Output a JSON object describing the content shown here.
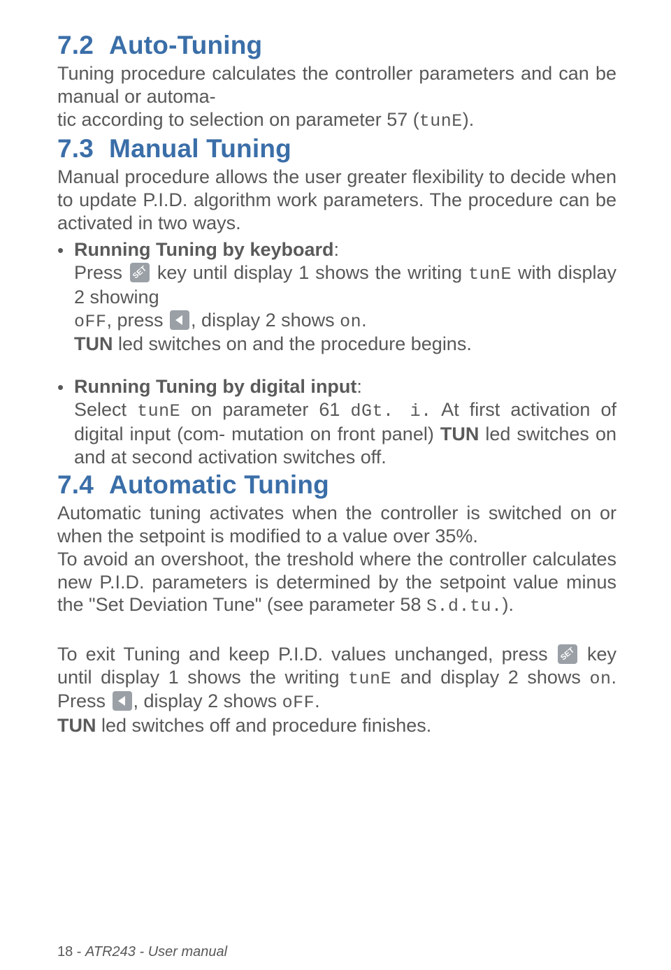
{
  "sections": {
    "s72": {
      "num": "7.2",
      "title": "Auto-Tuning"
    },
    "s73": {
      "num": "7.3",
      "title": "Manual Tuning"
    },
    "s74": {
      "num": "7.4",
      "title": "Automatic Tuning"
    }
  },
  "p72": {
    "a": "Tuning procedure calculates the controller parameters and can be manual or automa-",
    "b": "tic according to selection on parameter 57 (",
    "b_seg": "tunE",
    "c": ")."
  },
  "p73_intro": {
    "a": "Manual procedure allows the user greater flexibility to decide when to update P.I.D. algorithm work parameters. The procedure can be activated in two ways."
  },
  "p73_bullet1": {
    "title": "Running Tuning by keyboard",
    "l1a": "Press ",
    "l1b": " key until display 1 shows the writing ",
    "l1b_seg": "tunE",
    "l1c": " with display 2 showing ",
    "l2a_seg": "oFF",
    "l2b": ", press ",
    "l2c": ", display 2 shows ",
    "l2c_seg": "on",
    "l2d": ".",
    "l3a": "TUN",
    "l3b": " led switches on and the procedure begins."
  },
  "p73_bullet2": {
    "title": "Running Tuning by digital input",
    "l1a": "Select ",
    "l1a_seg": "tunE",
    "l1b": " on parameter 61 ",
    "l1b_seg": "dGt. i.",
    "l1c": "  At first activation of digital input (com-",
    "l2": "mutation on front panel) ",
    "l2b": "TUN",
    "l2c": " led switches on and at second activation switches off."
  },
  "p74": {
    "a": "Automatic tuning activates when the controller is switched on or when the setpoint is modified to a value over 35%.",
    "b": "To avoid an overshoot, the treshold where the controller calculates new P.I.D. parameters is determined by the setpoint value minus the \"Set Deviation Tune\" (see parameter 58 ",
    "b_seg": "S.d.tu.",
    "c": ")."
  },
  "p_exit": {
    "a": "To exit Tuning and keep P.I.D. values unchanged, press ",
    "b": " key until display 1 shows the writing ",
    "b_seg": "tunE",
    "c": " and display 2 shows ",
    "c_seg": "on",
    "d": ". Press ",
    "e": ", display 2 shows ",
    "e_seg": "oFF",
    "f": ".",
    "g1": "TUN",
    "g2": " led switches off and procedure finishes."
  },
  "footer": {
    "page": "18",
    "sep": " - ",
    "doc": "ATR243 - User manual"
  }
}
